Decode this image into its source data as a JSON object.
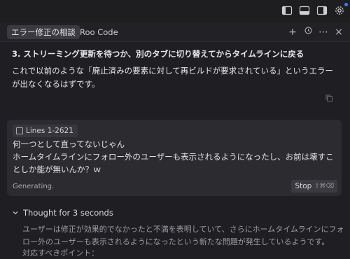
{
  "tabs": [
    {
      "label": "エラー修正の相談",
      "active": true
    },
    {
      "label": "Roo Code",
      "active": false
    }
  ],
  "tab_actions": [
    "plus-icon",
    "history-icon",
    "more-icon",
    "close-icon"
  ],
  "message": {
    "step_title": "3. ストリーミング更新を待つか、別のタブに切り替えてからタイムラインに戻る",
    "body": "これで以前のような「廃止済みの要素に対して再ビルドが要求されている」というエラーが出なくなるはずです。"
  },
  "input": {
    "chip_label": "Lines 1-2621",
    "line1": "何一つとして直ってないじゃん",
    "line2": "ホームタイムラインにフォロー外のユーザーも表示されるようになったし、お前は壊すことしか能が無いんか？ｗ",
    "status": "Generating.",
    "stop_label": "Stop",
    "stop_shortcut": "⇧⌘⌫"
  },
  "thought": {
    "label": "Thought for 3 seconds",
    "text": "ユーザーは修正が効果的でなかったと不満を表明していて、さらにホームタイムラインにフォロー外のユーザーも表示されるようになったという新たな問題が発生しているようです。",
    "sub": "対応すべきポイント："
  },
  "colors": {
    "background": "#1f1f23",
    "card": "#2b2b30",
    "accent_dot": "#3b82f6"
  }
}
